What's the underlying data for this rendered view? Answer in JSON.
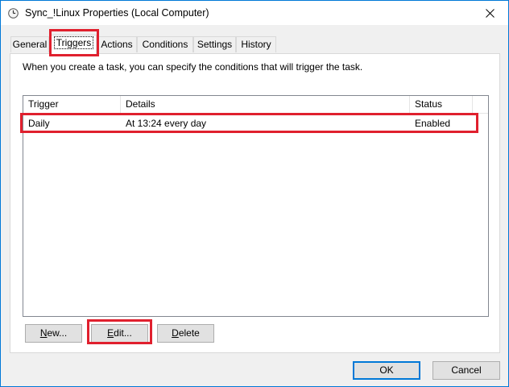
{
  "window": {
    "title": "Sync_!Linux Properties (Local Computer)",
    "accent_color": "#0078d7",
    "close_icon": "close-icon",
    "title_icon": "task-clock-icon"
  },
  "tabs": [
    {
      "label": "General",
      "active": false
    },
    {
      "label": "Triggers",
      "active": true
    },
    {
      "label": "Actions",
      "active": false
    },
    {
      "label": "Conditions",
      "active": false
    },
    {
      "label": "Settings",
      "active": false
    },
    {
      "label": "History",
      "active": false
    }
  ],
  "triggers_page": {
    "description": "When you create a task, you can specify the conditions that will trigger the task.",
    "columns": [
      "Trigger",
      "Details",
      "Status"
    ],
    "rows": [
      {
        "trigger": "Daily",
        "details": "At 13:24 every day",
        "status": "Enabled"
      }
    ],
    "buttons": {
      "new_prefix": "",
      "new_mnemonic": "N",
      "new_suffix": "ew...",
      "edit_prefix": "",
      "edit_mnemonic": "E",
      "edit_suffix": "dit...",
      "delete_prefix": "",
      "delete_mnemonic": "D",
      "delete_suffix": "elete"
    }
  },
  "footer": {
    "ok_label": "OK",
    "cancel_label": "Cancel"
  },
  "highlight_color": "#e0202e"
}
